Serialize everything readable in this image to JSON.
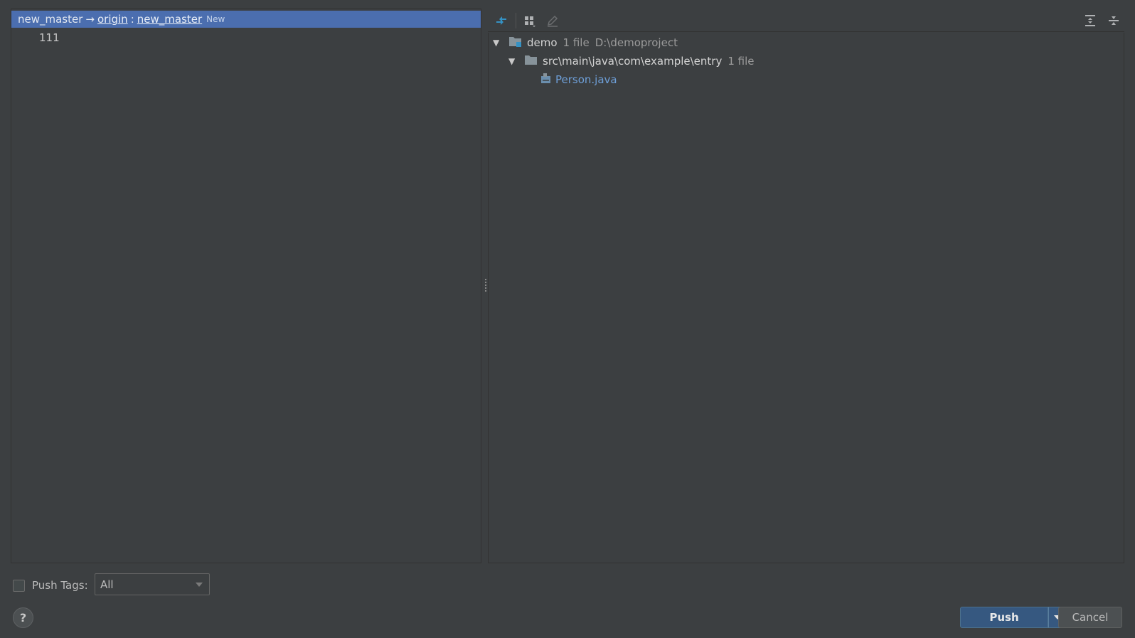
{
  "commits_panel": {
    "branch": {
      "local": "new_master",
      "arrow": "→",
      "remote": "origin",
      "separator": ":",
      "remote_branch": "new_master",
      "badge": "New"
    },
    "commits": [
      {
        "message": "111"
      }
    ]
  },
  "toolbar": {
    "icons": [
      "expand-collapse-icon",
      "group-by-icon",
      "edit-icon",
      "expand-all-icon",
      "collapse-all-icon"
    ]
  },
  "file_tree": {
    "root": {
      "name": "demo",
      "count": "1 file",
      "path": "D:\\demoproject"
    },
    "folder": {
      "name": "src\\main\\java\\com\\example\\entry",
      "count": "1 file"
    },
    "file": {
      "name": "Person.java"
    }
  },
  "bottom": {
    "push_tags_label": "Push Tags:",
    "push_tags_value": "All",
    "help_label": "?",
    "push_label": "Push",
    "cancel_label": "Cancel"
  },
  "colors": {
    "background": "#3c3f41",
    "selection": "#4b6eaf",
    "primary_button": "#365880",
    "file_link": "#6e9fd8"
  }
}
